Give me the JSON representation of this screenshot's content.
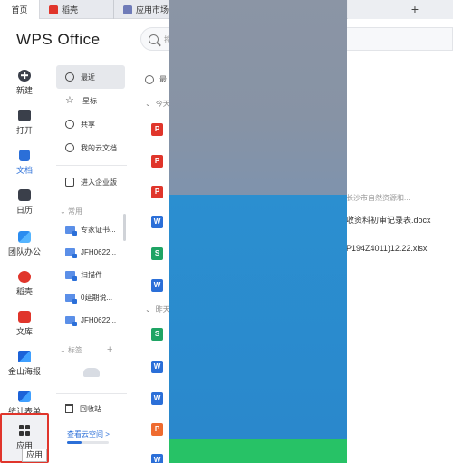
{
  "tabs": [
    {
      "label": "首页"
    },
    {
      "label": "稻壳"
    },
    {
      "label": "应用市场"
    }
  ],
  "new_tab": "+",
  "app": {
    "logo": "WPS Office"
  },
  "search": {
    "placeholder": "搜"
  },
  "rail": [
    {
      "label": "新建",
      "icon": "plus-circle-icon"
    },
    {
      "label": "打开",
      "icon": "folder-icon"
    },
    {
      "label": "文档",
      "icon": "document-icon",
      "active": true
    },
    {
      "label": "日历",
      "icon": "calendar-icon"
    },
    {
      "label": "团队办公",
      "icon": "team-icon"
    },
    {
      "label": "稻壳",
      "icon": "daoke-icon"
    },
    {
      "label": "文库",
      "icon": "library-icon"
    },
    {
      "label": "金山海报",
      "icon": "poster-icon"
    },
    {
      "label": "统计表单",
      "icon": "form-icon"
    },
    {
      "label": "应用",
      "icon": "apps-grid-icon"
    }
  ],
  "tooltip": "应用",
  "nav": {
    "recent": "最近",
    "starred": "星标",
    "shared": "共享",
    "cloud": "我的云文档",
    "enterprise": "进入企业版",
    "common_header": "常用",
    "common": [
      "专家证书...",
      "JFH0622...",
      "扫描件",
      "0延期说...",
      "JFH0622..."
    ],
    "tags_header": "标签",
    "trash": "回收站",
    "cloud_space": "查看云空间 >",
    "cloud_usage_fraction": 0.35
  },
  "list": {
    "header": "最",
    "groups": {
      "today": "今天",
      "yesterday": "昨天"
    },
    "visible_names": [
      {
        "path": "长沙市自然资源和..."
      },
      {
        "name": "收资料初审记录表.docx"
      },
      {
        "name": "P194Z4011)12.22.xlsx"
      }
    ],
    "icons": [
      "P",
      "P",
      "P",
      "W",
      "S",
      "W",
      "S",
      "W",
      "W",
      "P",
      "W"
    ]
  },
  "colors": {
    "accent": "#2b6fd8",
    "brand_red": "#e0352b",
    "overlay_gray": "#8b95a5",
    "overlay_blue": "#2b8fd0",
    "overlay_green": "#27c266"
  }
}
